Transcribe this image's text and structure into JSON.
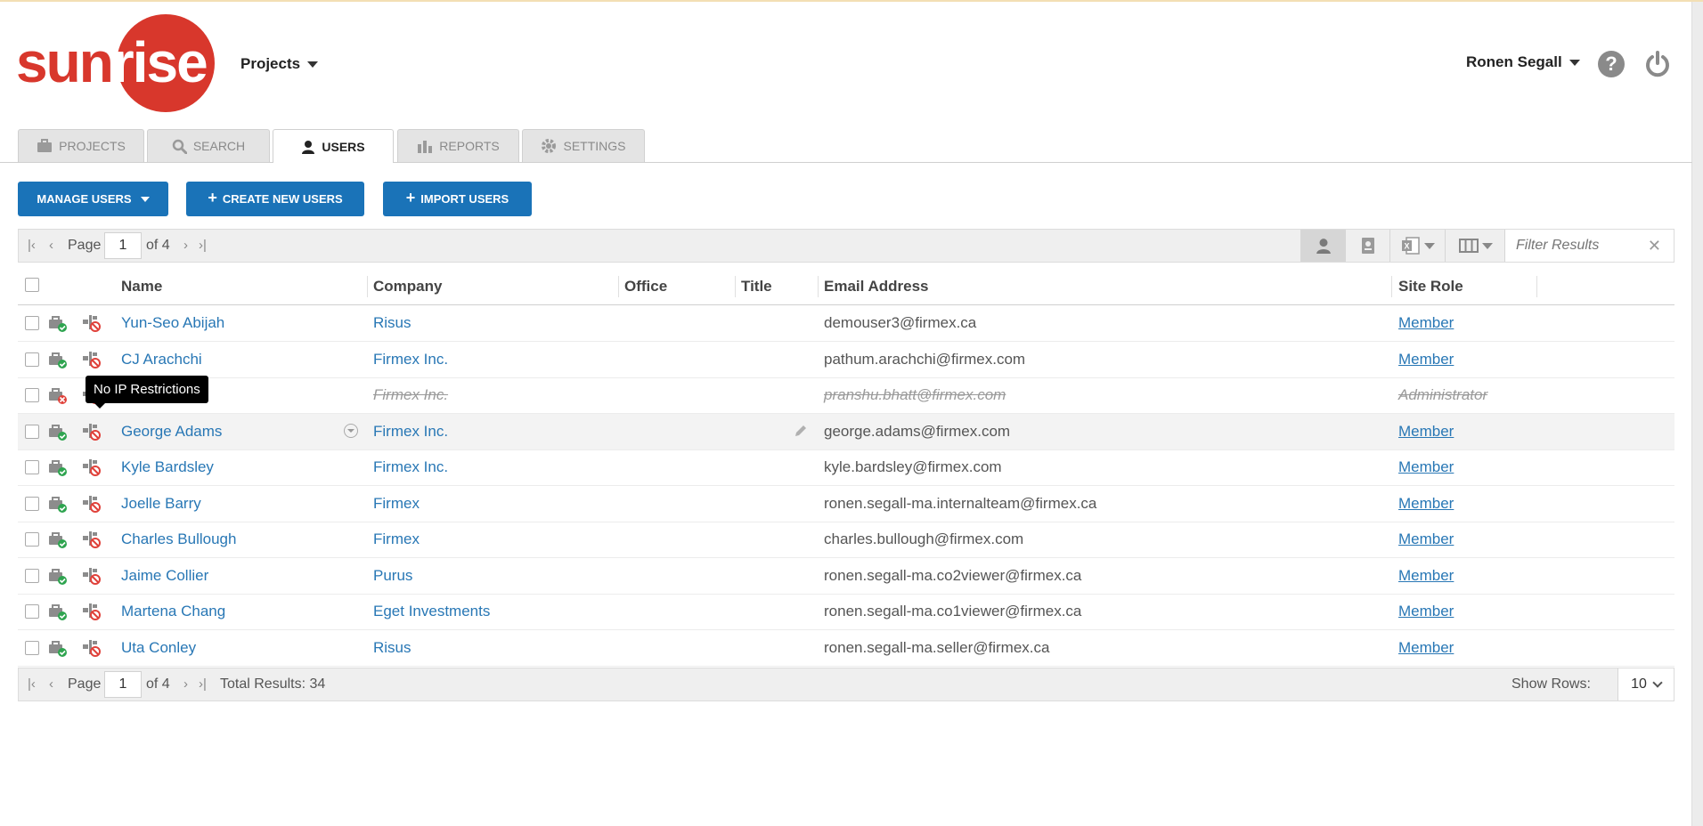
{
  "brand": {
    "part1": "sun",
    "part2": "rise",
    "color": "#d8372c"
  },
  "header": {
    "projects_label": "Projects",
    "user_name": "Ronen Segall",
    "help_glyph": "?"
  },
  "tabs": [
    {
      "label": "PROJECTS",
      "icon": "briefcase-icon"
    },
    {
      "label": "SEARCH",
      "icon": "search-icon"
    },
    {
      "label": "USERS",
      "icon": "user-icon",
      "active": true
    },
    {
      "label": "REPORTS",
      "icon": "bar-chart-icon"
    },
    {
      "label": "SETTINGS",
      "icon": "gear-icon"
    }
  ],
  "actions": {
    "manage_users": "MANAGE USERS",
    "create_new_users": "CREATE NEW USERS",
    "import_users": "IMPORT USERS",
    "plus": "+"
  },
  "pager": {
    "first": "K",
    "prev": "‹",
    "next": "›",
    "last": "›|",
    "page_label": "Page",
    "page_value": "1",
    "of_label": "of 4",
    "total_results": "Total Results: 34",
    "show_rows_label": "Show Rows:",
    "rows_value": "10",
    "filter_placeholder": "Filter Results",
    "filter_clear": "✕"
  },
  "table": {
    "columns": {
      "name": "Name",
      "company": "Company",
      "office": "Office",
      "title": "Title",
      "email": "Email Address",
      "site_role": "Site Role"
    },
    "rows": [
      {
        "name": "Yun-Seo Abijah",
        "company": "Risus",
        "email": "demouser3@firmex.ca",
        "role": "Member"
      },
      {
        "name": "CJ Arachchi",
        "company": "Firmex Inc.",
        "email": "pathum.arachchi@firmex.com",
        "role": "Member"
      },
      {
        "name": "",
        "company": "Firmex Inc.",
        "email": "pranshu.bhatt@firmex.com",
        "role": "Administrator",
        "disabled": true
      },
      {
        "name": "George Adams",
        "company": "Firmex Inc.",
        "email": "george.adams@firmex.com",
        "role": "Member",
        "hover": true
      },
      {
        "name": "Kyle Bardsley",
        "company": "Firmex Inc.",
        "email": "kyle.bardsley@firmex.com",
        "role": "Member"
      },
      {
        "name": "Joelle Barry",
        "company": "Firmex",
        "email": "ronen.segall-ma.internalteam@firmex.ca",
        "role": "Member"
      },
      {
        "name": "Charles Bullough",
        "company": "Firmex",
        "email": "charles.bullough@firmex.com",
        "role": "Member"
      },
      {
        "name": "Jaime Collier",
        "company": "Purus",
        "email": "ronen.segall-ma.co2viewer@firmex.ca",
        "role": "Member"
      },
      {
        "name": "Martena Chang",
        "company": "Eget Investments",
        "email": "ronen.segall-ma.co1viewer@firmex.ca",
        "role": "Member"
      },
      {
        "name": "Uta Conley",
        "company": "Risus",
        "email": "ronen.segall-ma.seller@firmex.ca",
        "role": "Member"
      }
    ]
  },
  "tooltip": {
    "text": "No IP Restrictions"
  },
  "colors": {
    "primary_button": "#1a73b8",
    "link": "#2877b5",
    "status_ok": "#2ea44f",
    "status_blocked": "#e0413a"
  }
}
